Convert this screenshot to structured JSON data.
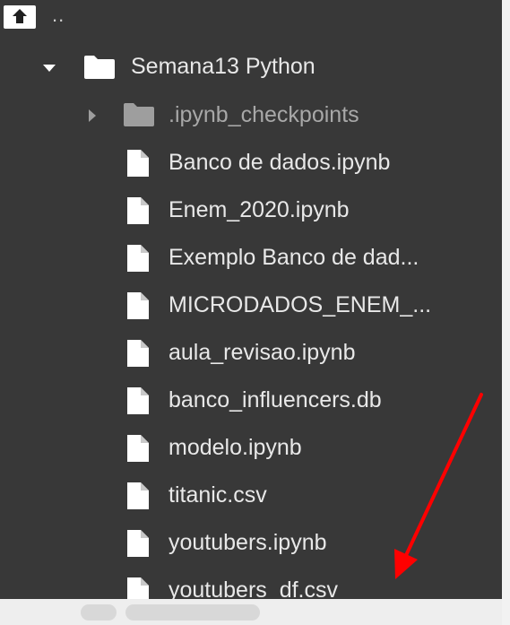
{
  "parent": {
    "label": ".."
  },
  "tree": {
    "root_folder": {
      "label": "Semana13 Python",
      "expanded": true
    },
    "items": [
      {
        "type": "folder",
        "label": ".ipynb_checkpoints",
        "dim": true
      },
      {
        "type": "file",
        "label": "Banco de dados.ipynb"
      },
      {
        "type": "file",
        "label": "Enem_2020.ipynb"
      },
      {
        "type": "file",
        "label": "Exemplo Banco de dad..."
      },
      {
        "type": "file",
        "label": "MICRODADOS_ENEM_..."
      },
      {
        "type": "file",
        "label": "aula_revisao.ipynb"
      },
      {
        "type": "file",
        "label": "banco_influencers.db"
      },
      {
        "type": "file",
        "label": "modelo.ipynb"
      },
      {
        "type": "file",
        "label": "titanic.csv"
      },
      {
        "type": "file",
        "label": "youtubers.ipynb"
      },
      {
        "type": "file",
        "label": "youtubers_df.csv"
      }
    ]
  },
  "colors": {
    "panel_bg": "#383838",
    "text": "#e8e8e8",
    "text_dim": "#a8a8a8",
    "folder_dim": "#9e9e9e",
    "icon": "#ffffff",
    "arrow": "#ff0000"
  }
}
